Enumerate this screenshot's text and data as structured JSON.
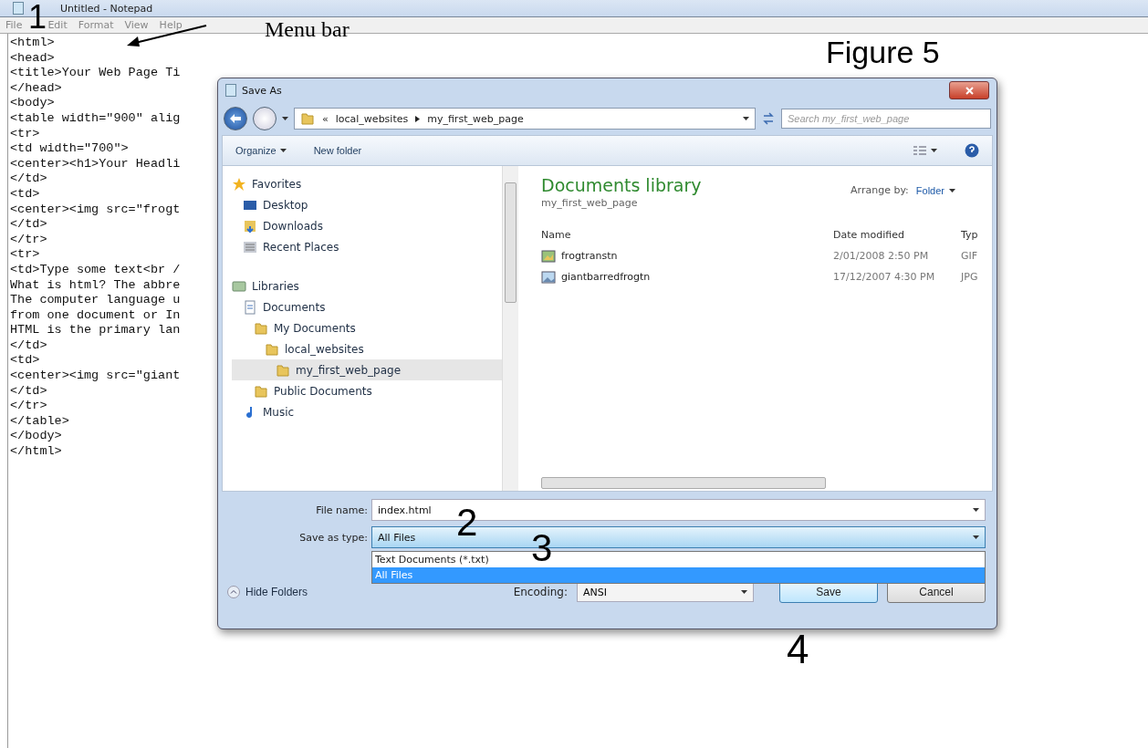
{
  "notepad": {
    "title": "Untitled - Notepad",
    "menu": [
      "File",
      "Edit",
      "Format",
      "View",
      "Help"
    ],
    "lines": [
      "<html>",
      "<head>",
      "<title>Your Web Page Ti",
      "</head>",
      "<body>",
      "<table width=\"900\" alig",
      "<tr>",
      "<td width=\"700\">",
      "<center><h1>Your Headli",
      "</td>",
      "<td>",
      "<center><img src=\"frogt",
      "</td>",
      "</tr>",
      "<tr>",
      "<td>Type some text<br /",
      "What is html? The abbre",
      "The computer language u",
      "from one document or In",
      "HTML is the primary lan",
      "</td>",
      "<td>",
      "<center><img src=\"giant",
      "</td>",
      "</tr>",
      "</table>",
      "</body>",
      "</html>"
    ]
  },
  "dialog": {
    "title": "Save As",
    "address": {
      "overflow": "«",
      "path": [
        "local_websites",
        "my_first_web_page"
      ]
    },
    "search": {
      "placeholder": "Search my_first_web_page"
    },
    "toolbar": {
      "organize": "Organize",
      "new_folder": "New folder"
    },
    "nav": [
      {
        "label": "Favorites",
        "kind": "star",
        "selected": false,
        "children": [
          {
            "label": "Desktop",
            "kind": "desktop",
            "selected": false
          },
          {
            "label": "Downloads",
            "kind": "downloads",
            "selected": false
          },
          {
            "label": "Recent Places",
            "kind": "recent",
            "selected": false
          }
        ]
      },
      {
        "label": "Libraries",
        "kind": "library",
        "selected": false,
        "children": [
          {
            "label": "Documents",
            "kind": "documents",
            "selected": false,
            "children": [
              {
                "label": "My Documents",
                "kind": "folder",
                "selected": false,
                "children": [
                  {
                    "label": "local_websites",
                    "kind": "folder",
                    "selected": false,
                    "children": [
                      {
                        "label": "my_first_web_page",
                        "kind": "folder",
                        "selected": true
                      }
                    ]
                  }
                ]
              },
              {
                "label": "Public Documents",
                "kind": "folder",
                "selected": false
              }
            ]
          },
          {
            "label": "Music",
            "kind": "music",
            "selected": false
          }
        ]
      }
    ],
    "library": {
      "title": "Documents library",
      "subtitle": "my_first_web_page",
      "arrange_label": "Arrange by:",
      "arrange_value": "Folder"
    },
    "columns": [
      "Name",
      "Date modified",
      "Typ"
    ],
    "files": [
      {
        "name": "frogtranstn",
        "kind": "gif",
        "date": "2/01/2008 2:50 PM",
        "type": "GIF"
      },
      {
        "name": "giantbarredfrogtn",
        "kind": "jpg",
        "date": "17/12/2007 4:30 PM",
        "type": "JPG"
      }
    ],
    "file_name": {
      "label": "File name:",
      "value": "index.html"
    },
    "save_type": {
      "label": "Save as type:",
      "value": "All Files",
      "options": [
        {
          "label": "Text Documents (*.txt)",
          "selected": false
        },
        {
          "label": "All Files",
          "selected": true
        }
      ]
    },
    "hide_folders": "Hide Folders",
    "encoding": {
      "label": "Encoding:",
      "value": "ANSI"
    },
    "buttons": [
      "Save",
      "Cancel"
    ]
  },
  "annotations": {
    "figure": "Figure 5",
    "menu_bar": "Menu bar",
    "steps": [
      "1",
      "2",
      "3",
      "4"
    ]
  }
}
